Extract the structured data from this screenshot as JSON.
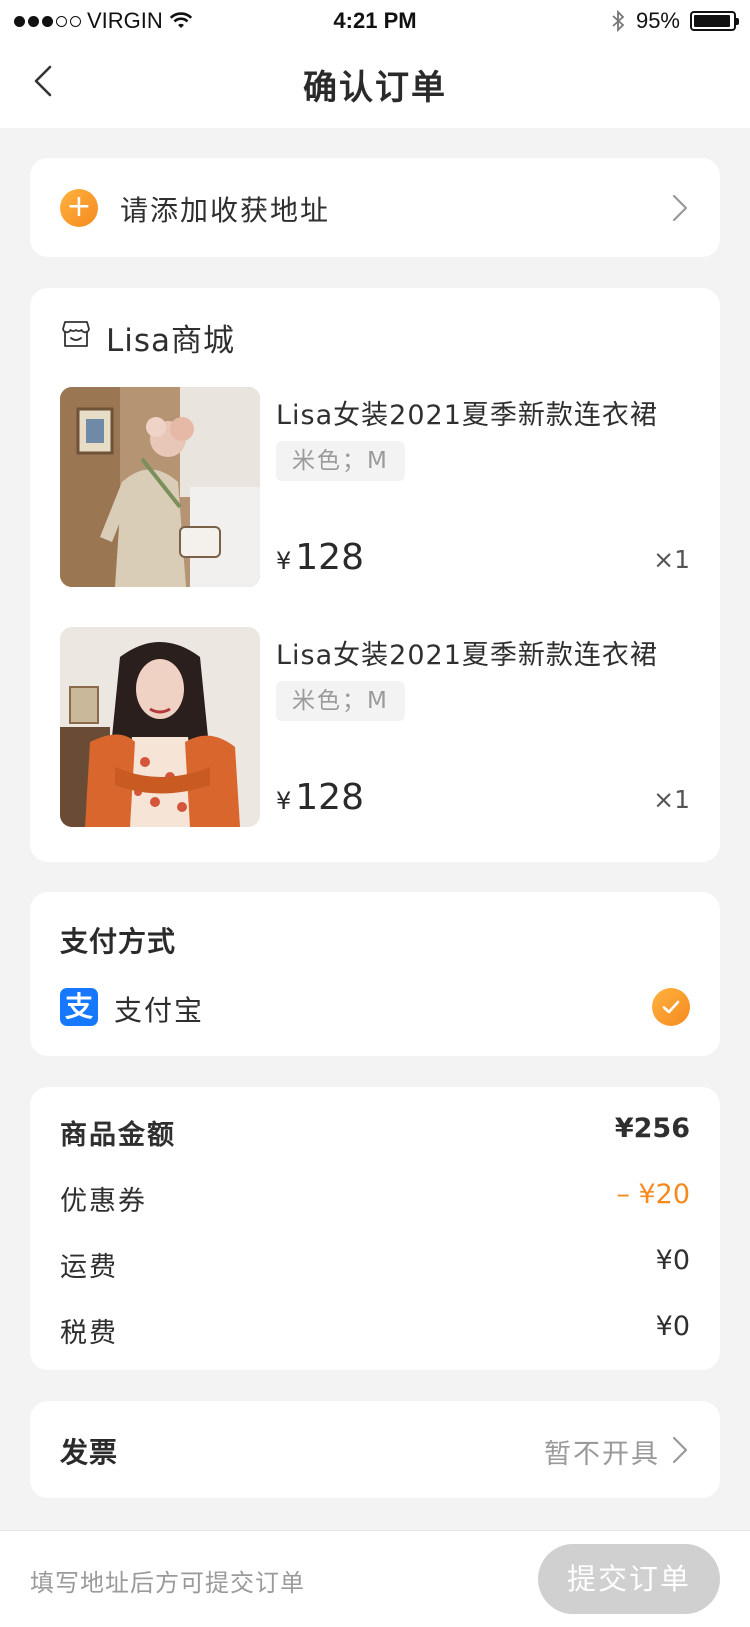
{
  "status_bar": {
    "carrier": "VIRGIN",
    "time": "4:21 PM",
    "battery": "95%",
    "battery_level": 0.95
  },
  "nav": {
    "title": "确认订单"
  },
  "address": {
    "label": "请添加收获地址"
  },
  "store": {
    "name": "Lisa商城",
    "products": [
      {
        "title": "Lisa女装2021夏季新款连衣裙",
        "spec": "米色；M",
        "currency": "¥",
        "price": "128",
        "qty": "×1"
      },
      {
        "title": "Lisa女装2021夏季新款连衣裙",
        "spec": "米色；M",
        "currency": "¥",
        "price": "128",
        "qty": "×1"
      }
    ]
  },
  "payment": {
    "title": "支付方式",
    "method": "支付宝",
    "icon_glyph": "支"
  },
  "amounts": {
    "goods_label": "商品金额",
    "goods_value": "¥256",
    "coupon_label": "优惠券",
    "coupon_value": "– ¥20",
    "shipping_label": "运费",
    "shipping_value": "¥0",
    "tax_label": "税费",
    "tax_value": "¥0"
  },
  "invoice": {
    "label": "发票",
    "value": "暂不开具"
  },
  "bottom": {
    "hint": "填写地址后方可提交订单",
    "submit_label": "提交订单"
  },
  "colors": {
    "accent": "#f58a1e",
    "alipay": "#1677ff",
    "disabled_button": "#d0d0d0"
  }
}
